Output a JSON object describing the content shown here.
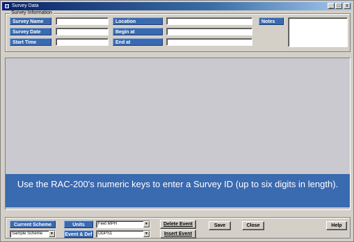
{
  "window": {
    "title": "Survey Data",
    "minimize_glyph": "_",
    "restore_glyph": "□",
    "close_glyph": "x"
  },
  "survey_info": {
    "group_title": "Survey Information",
    "survey_name_label": "Survey Name",
    "survey_date_label": "Survey Date",
    "start_time_label": "Start Time",
    "location_label": "Location",
    "begin_at_label": "Begin at",
    "end_at_label": "End at",
    "notes_label": "Notes"
  },
  "message": "Use the RAC-200's numeric keys to enter a Survey ID (up to six digits in length).",
  "bottom": {
    "current_scheme_label": "Current Scheme",
    "scheme_value": "Sample Scheme",
    "units_label": "Units",
    "units_value": "Feet MPH",
    "event_def_label": "Event & Def",
    "event_def_value": "ODPS1",
    "delete_event_label": "Delete Event",
    "insert_event_label": "Insert Event",
    "save_label": "Save",
    "close_label": "Close",
    "help_label": "Help",
    "dropdown_glyph": "▼"
  }
}
